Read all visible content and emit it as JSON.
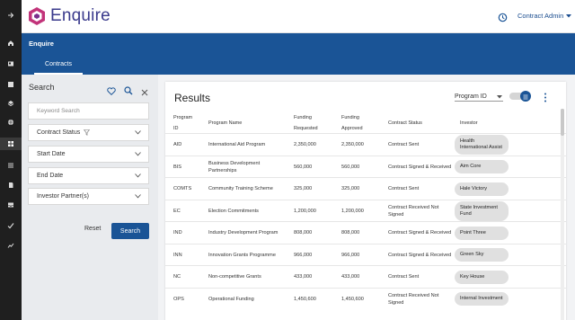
{
  "brand": {
    "name": "Enquire"
  },
  "header": {
    "user_label": "Contract Admin"
  },
  "app_bar": {
    "app_name": "Enquire",
    "tab_label": "Contracts"
  },
  "search_panel": {
    "title": "Search",
    "keyword_placeholder": "Keyword Search",
    "filters": [
      {
        "label": "Contract Status"
      },
      {
        "label": "Start Date"
      },
      {
        "label": "End Date"
      },
      {
        "label": "Investor Partner(s)"
      }
    ],
    "reset_label": "Reset",
    "search_label": "Search"
  },
  "results": {
    "title": "Results",
    "sort_value": "Program ID",
    "columns": {
      "program_id": [
        "Program",
        "ID"
      ],
      "program_name": "Program Name",
      "funding_requested": [
        "Funding",
        "Requested"
      ],
      "funding_approved": [
        "Funding",
        "Approved"
      ],
      "contract_status": "Contract Status",
      "investor": "Investor"
    },
    "rows": [
      {
        "id": "AID",
        "name": "International Aid Program",
        "requested": "2,350,000",
        "approved": "2,350,000",
        "status": "Contract Sent",
        "investor": "Health International Assist"
      },
      {
        "id": "BIS",
        "name": "Business Development Partnerships",
        "requested": "560,000",
        "approved": "560,000",
        "status": "Contract Signed & Received",
        "investor": "Aim Core"
      },
      {
        "id": "COMTS",
        "name": "Community Training Scheme",
        "requested": "325,000",
        "approved": "325,000",
        "status": "Contract Sent",
        "investor": "Hale Victory"
      },
      {
        "id": "EC",
        "name": "Election Commitments",
        "requested": "1,200,000",
        "approved": "1,200,000",
        "status": "Contract Received Not Signed",
        "investor": "State Investment Fund"
      },
      {
        "id": "IND",
        "name": "Industry Development Program",
        "requested": "808,000",
        "approved": "808,000",
        "status": "Contract Signed & Received",
        "investor": "Point Three"
      },
      {
        "id": "INN",
        "name": "Innovation Grants Programme",
        "requested": "966,000",
        "approved": "966,000",
        "status": "Contract Signed & Received",
        "investor": "Green Sky"
      },
      {
        "id": "NC",
        "name": "Non-competitive Grants",
        "requested": "433,000",
        "approved": "433,000",
        "status": "Contract Sent",
        "investor": "Key House"
      },
      {
        "id": "OPS",
        "name": "Operational Funding",
        "requested": "1,450,600",
        "approved": "1,450,600",
        "status": "Contract Received Not Signed",
        "investor": "Internal Investment"
      }
    ]
  },
  "sidebar_icons": [
    "arrow-right-icon",
    "home-icon",
    "contact-card-icon",
    "package-icon",
    "layers-icon",
    "globe-icon",
    "grid-icon",
    "apps-icon",
    "document-icon",
    "inbox-icon",
    "check-icon",
    "trend-icon"
  ],
  "colors": {
    "primary": "#1a5496",
    "rail": "#1f1f1f",
    "brand_accent": "#c2347a"
  }
}
